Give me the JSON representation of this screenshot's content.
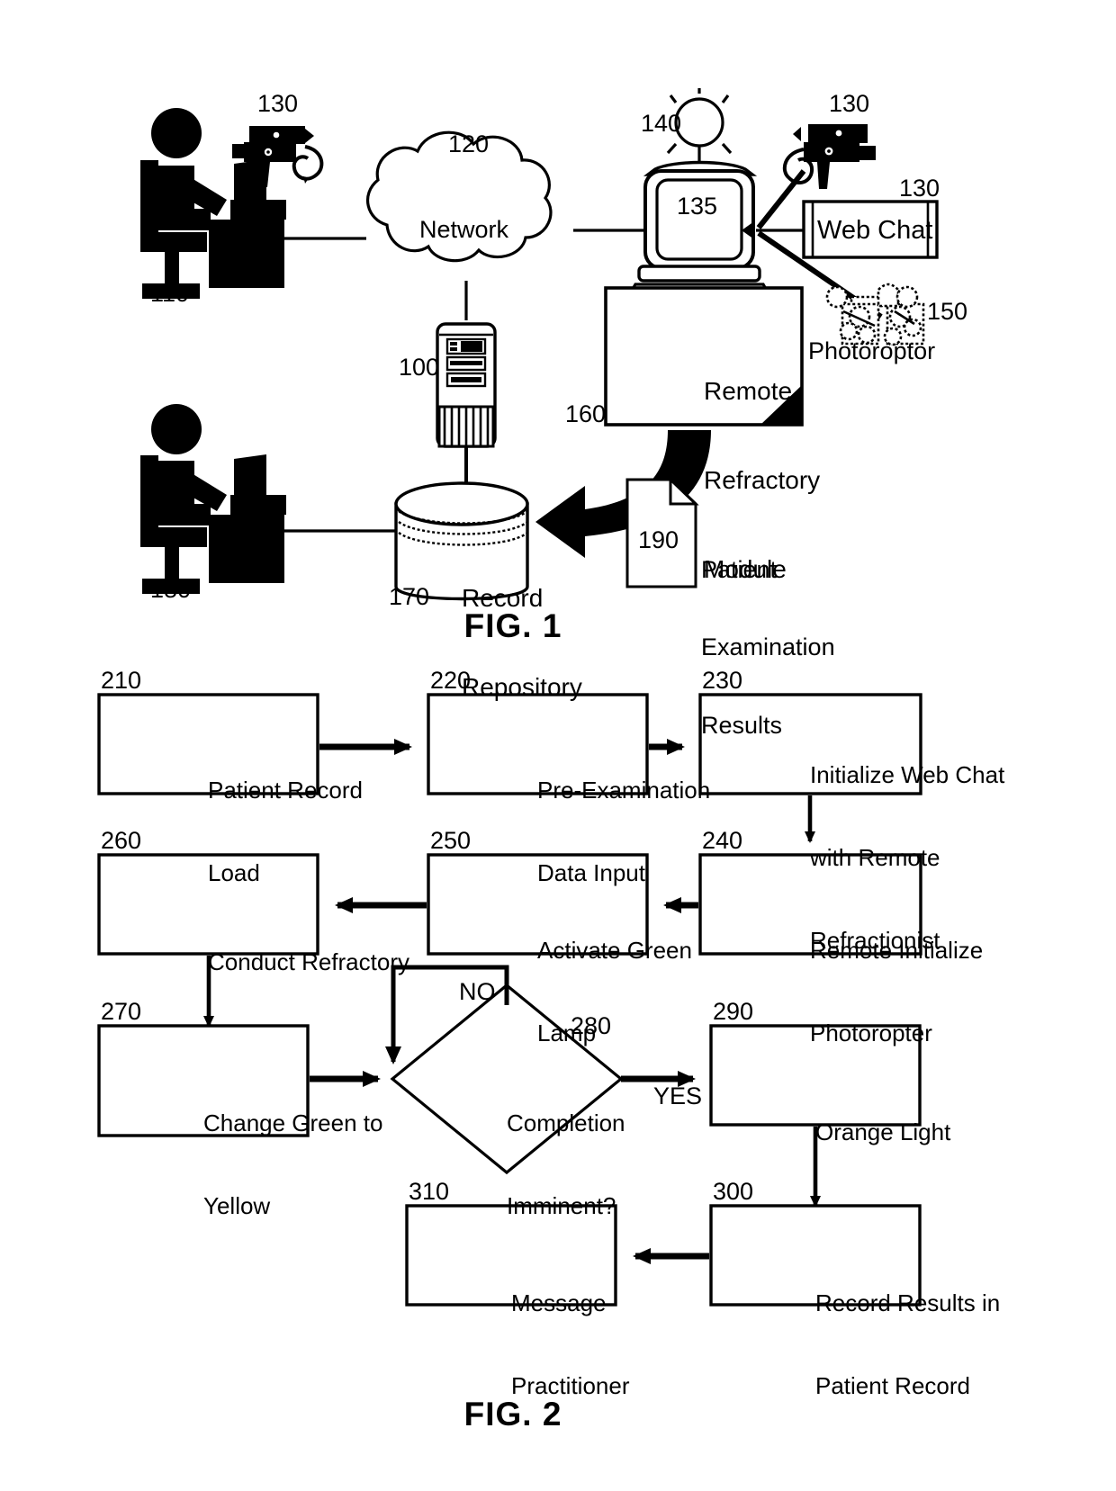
{
  "figure1": {
    "caption": "FIG. 1",
    "nodes": {
      "network": {
        "label": "Network",
        "ref": "120"
      },
      "patient_station": {
        "ref": "110"
      },
      "patient_camera": {
        "ref": "130"
      },
      "remote_camera": {
        "ref": "130"
      },
      "web_chat": {
        "label": "Web Chat",
        "ref": "130"
      },
      "server": {
        "ref": "100"
      },
      "lamp": {
        "ref": "140"
      },
      "monitor": {
        "ref": "135"
      },
      "photoroptor": {
        "label": "Photoroptor",
        "ref": "150"
      },
      "remote_module": {
        "label_lines": [
          "Remote",
          "Refractory",
          "Module"
        ],
        "ref": "160"
      },
      "record_repository": {
        "label_lines": [
          "Record",
          "Repository"
        ],
        "ref": "170"
      },
      "practitioner_station": {
        "ref": "180"
      },
      "exam_results": {
        "label_lines": [
          "Patient",
          "Examination",
          "Results"
        ],
        "ref": "190"
      }
    }
  },
  "figure2": {
    "caption": "FIG. 2",
    "steps": [
      {
        "ref": "210",
        "lines": [
          "Patient Record",
          "Load"
        ]
      },
      {
        "ref": "220",
        "lines": [
          "Pre-Examination",
          "Data Input"
        ]
      },
      {
        "ref": "230",
        "lines": [
          "Initialize Web Chat",
          "with Remote",
          "Refractionist"
        ]
      },
      {
        "ref": "240",
        "lines": [
          "Remote Initialize",
          "Photoropter"
        ]
      },
      {
        "ref": "250",
        "lines": [
          "Activate Green",
          "Lamp"
        ]
      },
      {
        "ref": "260",
        "lines": [
          "Conduct Refractory"
        ]
      },
      {
        "ref": "270",
        "lines": [
          "Change Green to",
          "Yellow"
        ]
      },
      {
        "ref": "280",
        "lines": [
          "Completion",
          "Imminent?"
        ],
        "shape": "decision"
      },
      {
        "ref": "290",
        "lines": [
          "Orange Light"
        ]
      },
      {
        "ref": "300",
        "lines": [
          "Record Results in",
          "Patient Record"
        ]
      },
      {
        "ref": "310",
        "lines": [
          "Message",
          "Practitioner"
        ]
      }
    ],
    "branch_labels": {
      "no": "NO",
      "yes": "YES"
    }
  },
  "colors": {
    "ink": "#000000",
    "paper": "#ffffff"
  }
}
